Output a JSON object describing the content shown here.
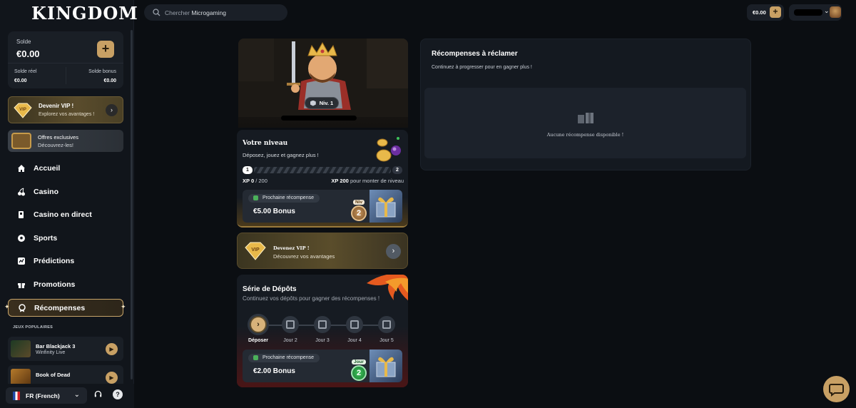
{
  "brand": {
    "logo_text": "KINGDOM"
  },
  "sidebar": {
    "balance": {
      "label": "Solde",
      "value": "€0.00",
      "add_icon": "plus-icon",
      "real_label": "Solde réel",
      "real_value": "€0.00",
      "bonus_label": "Solde bonus",
      "bonus_value": "€0.00"
    },
    "vip": {
      "title": "Devenir VIP !",
      "subtitle": "Explorez vos avantages !",
      "badge_text": "VIP"
    },
    "offers": {
      "title": "Offres exclusives",
      "subtitle": "Découvrez-les!"
    },
    "nav": [
      {
        "label": "Accueil",
        "icon": "home-icon"
      },
      {
        "label": "Casino",
        "icon": "cherries-icon"
      },
      {
        "label": "Casino en direct",
        "icon": "cards-icon"
      },
      {
        "label": "Sports",
        "icon": "soccer-ball-icon"
      },
      {
        "label": "Prédictions",
        "icon": "chart-icon"
      },
      {
        "label": "Promotions",
        "icon": "gift-icon"
      },
      {
        "label": "Récompenses",
        "icon": "medal-icon",
        "active": true
      }
    ],
    "popular_title": "JEUX POPULAIRES",
    "games": [
      {
        "name": "Bar Blackjack 3",
        "provider": "Winfinity Live"
      },
      {
        "name": "Book of Dead",
        "provider": ""
      }
    ],
    "language": "FR (French)"
  },
  "topbar": {
    "search_prefix": "Chercher ",
    "search_term": "Microgaming",
    "balance": "€0.00"
  },
  "level": {
    "badge": "Niv. 1",
    "title": "Votre niveau",
    "subtitle": "Déposez, jouez et gagnez plus !",
    "current_level": "1",
    "next_level": "2",
    "xp_label": "XP 0",
    "xp_total": " / 200",
    "xp_needed": "XP 200",
    "xp_needed_suffix": " pour monter de niveau",
    "xp_progress": 0,
    "next_reward_label": "Prochaine récompense",
    "next_reward_amount": "€5.00 Bonus",
    "next_reward_tag": "Niv",
    "next_reward_level": "2"
  },
  "vip_banner": {
    "title": "Devenez VIP !",
    "subtitle": "Découvrez vos avantages",
    "badge_text": "VIP"
  },
  "streak": {
    "title": "Série de Dépôts",
    "subtitle": "Continuez vos dépôts pour gagner des récompenses !",
    "days": [
      "Déposer",
      "Jour 2",
      "Jour 3",
      "Jour 4",
      "Jour 5"
    ],
    "next_reward_label": "Prochaine récompense",
    "next_reward_amount": "€2.00 Bonus",
    "next_reward_tag": "Jour",
    "next_reward_day": "2"
  },
  "rewards": {
    "title": "Récompenses à réclamer",
    "subtitle": "Continuez à progresser pour en gagner plus !",
    "empty_text": "Aucune récompense disponible !"
  },
  "colors": {
    "accent": "#c8a064",
    "background": "#0b0e12",
    "panel": "#161b22"
  }
}
